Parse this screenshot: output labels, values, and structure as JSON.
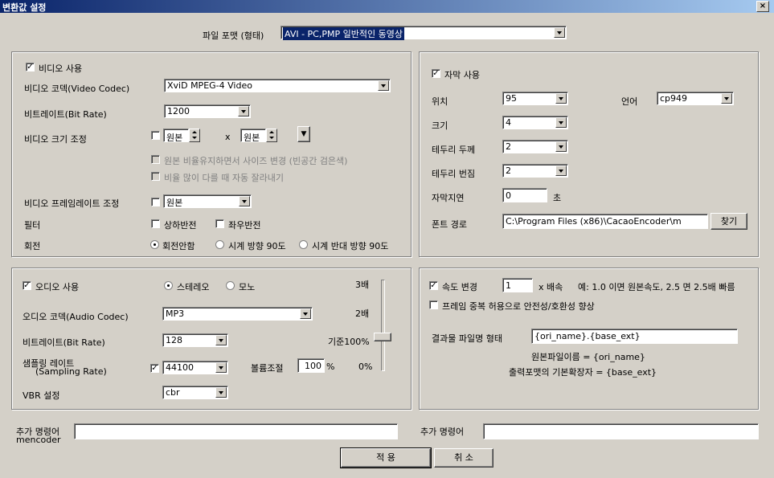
{
  "window": {
    "title": "변환값 설정",
    "close": "×"
  },
  "file_format": {
    "label": "파일 포맷 (형태)",
    "value": "AVI - PC,PMP 일반적인 동영상"
  },
  "video": {
    "enable_label": "비디오 사용",
    "enable_checked": true,
    "codec_label": "비디오 코덱(Video Codec)",
    "codec_value": "XviD MPEG-4 Video",
    "bitrate_label": "비트레이트(Bit Rate)",
    "bitrate_value": "1200",
    "resize_label": "비디오 크기 조정",
    "resize_w": "원본",
    "resize_x": "x",
    "resize_h": "원본",
    "keep_ratio_label": "원본 비율유지하면서 사이즈 변경 (빈공간 검은색)",
    "auto_crop_label": "비율 많이 다를 때 자동 잘라내기",
    "framerate_label": "비디오 프레임레이트 조정",
    "framerate_value": "원본",
    "filter_label": "필터",
    "flip_v_label": "상하반전",
    "flip_h_label": "좌우반전",
    "rotate_label": "회전",
    "rotate_none": "회전안함",
    "rotate_cw": "시계 방향 90도",
    "rotate_ccw": "시계 반대 방향 90도"
  },
  "subtitle": {
    "enable_label": "자막 사용",
    "enable_checked": true,
    "position_label": "위치",
    "position_value": "95",
    "language_label": "언어",
    "language_value": "cp949",
    "size_label": "크기",
    "size_value": "4",
    "border_label": "테두리 두께",
    "border_value": "2",
    "blur_label": "테두리 번짐",
    "blur_value": "2",
    "delay_label": "자막지연",
    "delay_value": "0",
    "delay_unit": "초",
    "font_label": "폰트 경로",
    "font_value": "C:\\Program Files (x86)\\CacaoEncoder\\m",
    "find_button": "찾기"
  },
  "audio": {
    "enable_label": "오디오 사용",
    "enable_checked": true,
    "stereo_label": "스테레오",
    "mono_label": "모노",
    "codec_label": "오디오 코덱(Audio Codec)",
    "codec_value": "MP3",
    "bitrate_label": "비트레이트(Bit Rate)",
    "bitrate_value": "128",
    "samplerate_label1": "샘플링 레이트",
    "samplerate_label2": "(Sampling Rate)",
    "samplerate_value": "44100",
    "volume_label": "볼륨조절",
    "volume_value": "100",
    "volume_unit": "%",
    "vbr_label": "VBR 설정",
    "vbr_value": "cbr",
    "scale": {
      "top": "3배",
      "mid": "2배",
      "base": "기준100%",
      "zero": "0%"
    }
  },
  "speed": {
    "change_label": "속도 변경",
    "change_checked": true,
    "value": "1",
    "unit": "x 배속",
    "example": "예: 1.0 이면 원본속도, 2.5 면 2.5배 빠름",
    "dup_label": "프레임 중복 허용으로 안전성/호환성 향상",
    "filename_label": "결과물 파일명 형태",
    "filename_value": "{ori_name}.{base_ext}",
    "hint1": "원본파일이름 = {ori_name}",
    "hint2": "출력포맷의 기본확장자 = {base_ext}"
  },
  "extra": {
    "left_label1": "추가 명령어",
    "left_label2": "mencoder",
    "left_value": "",
    "right_label": "추가 명령어",
    "right_value": ""
  },
  "buttons": {
    "apply": "적 용",
    "cancel": "취 소"
  }
}
